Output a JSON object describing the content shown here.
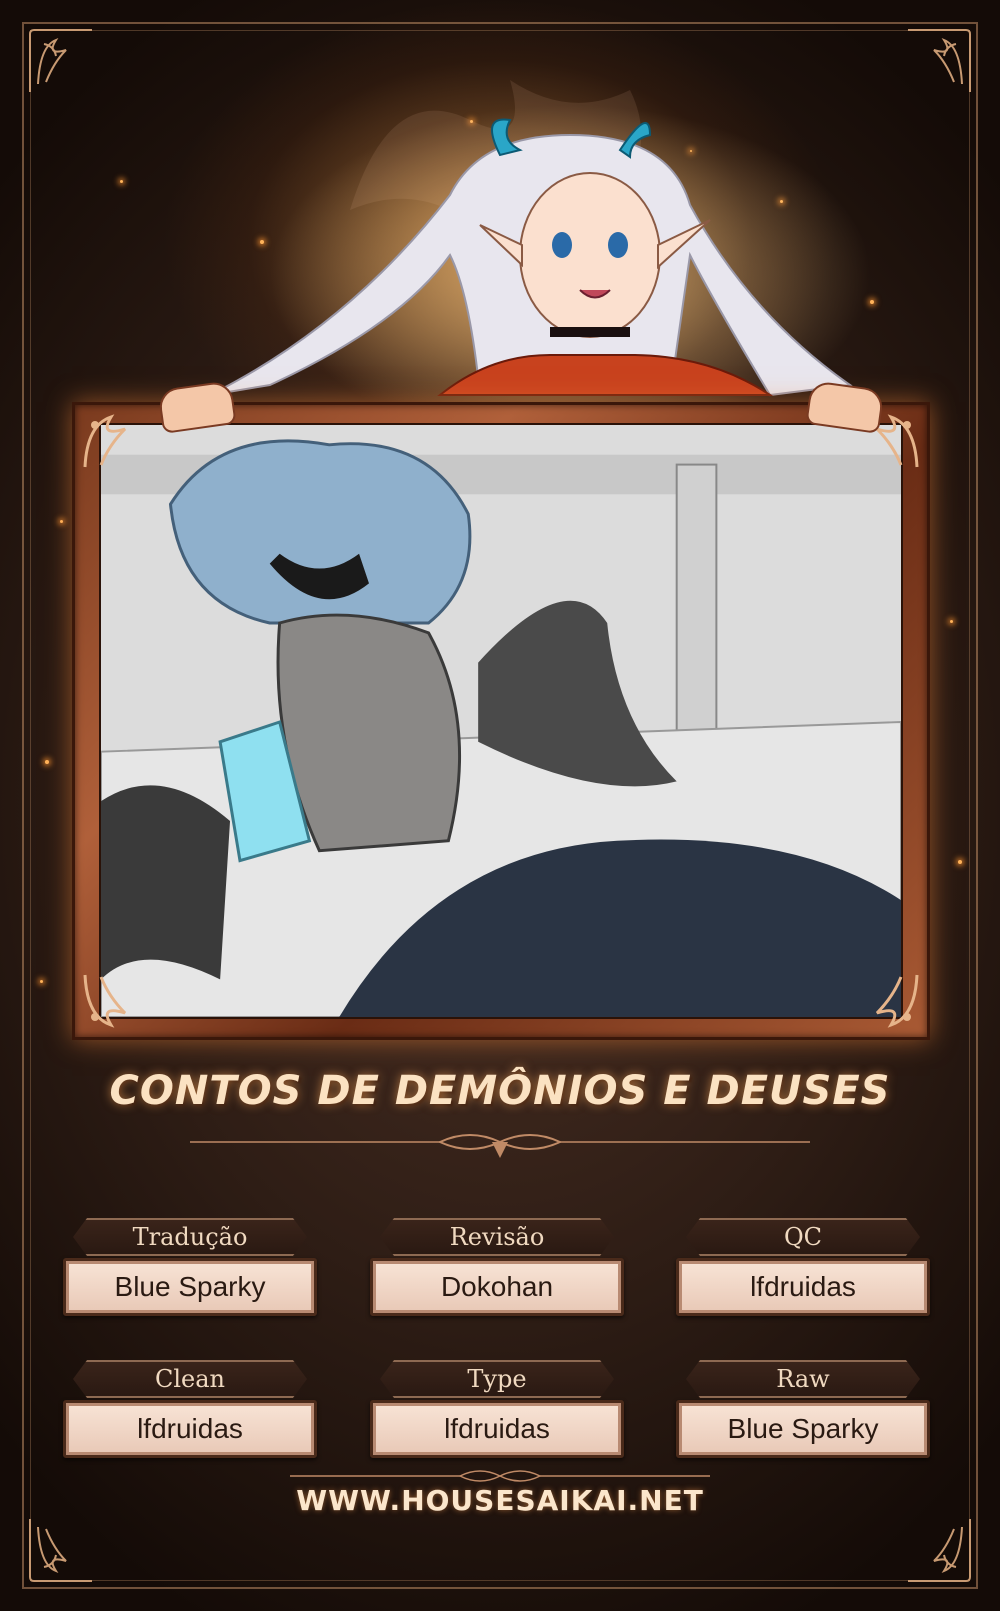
{
  "title": "CONTOS DE DEMÔNIOS E DEUSES",
  "credits": [
    {
      "role": "Tradução",
      "name": "Blue Sparky"
    },
    {
      "role": "Revisão",
      "name": "Dokohan"
    },
    {
      "role": "QC",
      "name": "lfdruidas"
    },
    {
      "role": "Clean",
      "name": "lfdruidas"
    },
    {
      "role": "Type",
      "name": "lfdruidas"
    },
    {
      "role": "Raw",
      "name": "Blue Sparky"
    }
  ],
  "url": "WWW.HOUSESAIKAI.NET",
  "colors": {
    "background": "#2e1d15",
    "frame": "#b0603a",
    "accent_glow": "#ffb35a",
    "title_text": "#fbe2c2",
    "plaque": "#f8e4d6"
  }
}
